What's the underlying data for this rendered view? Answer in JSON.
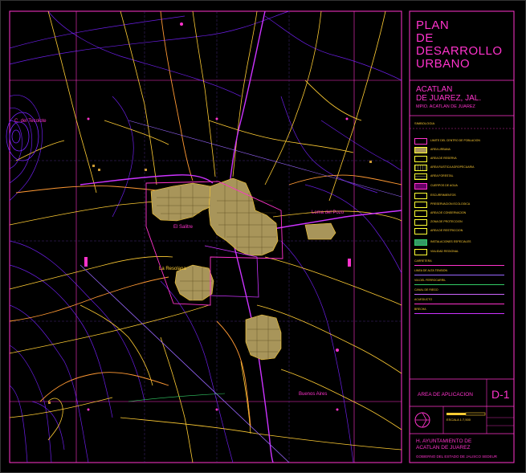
{
  "title_block": {
    "plan_title_lines": [
      "PLAN",
      "DE",
      "DESARROLLO",
      "URBANO"
    ],
    "town_lines": [
      "ACATLAN",
      "DE JUAREZ, JAL."
    ],
    "municipality": "MPIO. ACATLAN DE JUAREZ",
    "legend_heading": "SIMBOLOGIA",
    "sheet_label": "AREA DE APLICACION",
    "sheet_number": "D-1",
    "scale_text": "ESCALA 1:7,500",
    "council_lines": [
      "H. AYUNTAMIENTO DE",
      "ACATLAN DE JUAREZ"
    ],
    "government_line": "GOBIERNO DEL ESTADO DE JALISCO SEDEUR"
  },
  "legend_items": [
    {
      "label": "LIMITE DEL CENTRO DE POBLACION",
      "color": "#ff33cc"
    },
    {
      "label": "AREA URBANA",
      "color": "#cc9933"
    },
    {
      "label": "AREA DE RESERVA",
      "color": "#ffcc33"
    },
    {
      "label": "AREA RUSTICA AGROPECUARIA",
      "color": "#ffcc33"
    },
    {
      "label": "AREA FORESTAL",
      "color": "#ffcc33"
    },
    {
      "label": "CUERPOS DE AGUA",
      "color": "#ff33cc"
    },
    {
      "label": "ESCURRIMIENTOS",
      "color": "#ffcc33"
    },
    {
      "label": "PRESERVACION ECOLOGICA",
      "color": "#ffcc33"
    },
    {
      "label": "AREA DE CONSERVACION",
      "color": "#ffcc33"
    },
    {
      "label": "ZONA DE PROTECCION",
      "color": "#ffcc33"
    },
    {
      "label": "AREA DE RESTRICCION",
      "color": "#ffcc33"
    },
    {
      "label": "INSTALACIONES ESPECIALES",
      "color": "#33cc66"
    },
    {
      "label": "VIALIDAD REGIONAL",
      "color": "#ffcc33"
    }
  ],
  "line_legend": [
    {
      "label": "CARRETERA",
      "color": "#ff33cc"
    },
    {
      "label": "LINEA DE ALTA TENSION",
      "color": "#9966ff"
    },
    {
      "label": "VIA DEL FERROCARRIL",
      "color": "#33cc66"
    },
    {
      "label": "CANAL DE RIEGO",
      "color": "#cc66ff"
    },
    {
      "label": "ACUEDUCTO",
      "color": "#ff33cc"
    },
    {
      "label": "BRECHA",
      "color": "#cc33ff"
    }
  ],
  "map_labels": {
    "hill": "C. del Tecolote",
    "east_place": "Loma del Pozo",
    "southwest_place": "La Resolana",
    "west_place": "El Salitre",
    "southeast_place": "Buenos Aires"
  },
  "colors": {
    "frame": "#ff33cc",
    "road_yellow": "#ffcc33",
    "road_orange": "#ff9933",
    "contour_violet": "#7722ff",
    "highway": "#cc33ff",
    "power_line": "#9966ff",
    "urban": "#a8955a"
  }
}
